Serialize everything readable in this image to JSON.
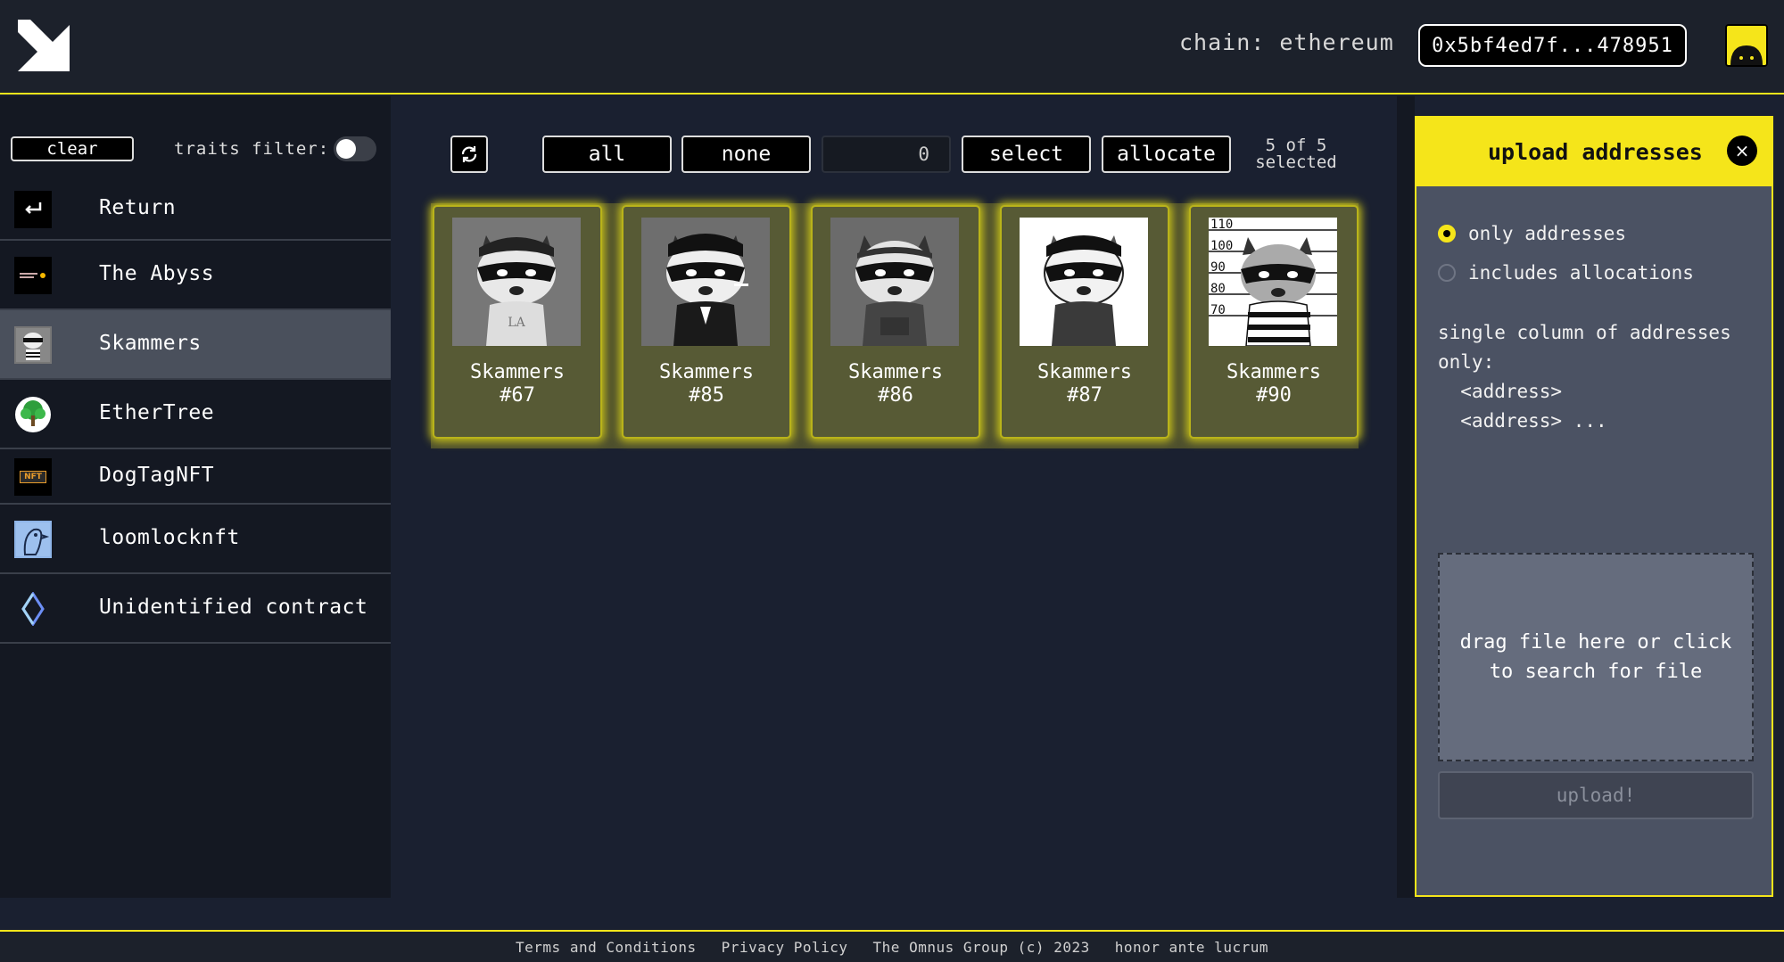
{
  "header": {
    "chain_text": "chain: ethereum",
    "wallet_address": "0x5bf4ed7f...478951"
  },
  "sidebar": {
    "clear_label": "clear",
    "traits_filter_label": "traits filter:",
    "traits_filter_on": false,
    "collections": [
      {
        "name": "Return",
        "icon": "return-icon",
        "active": false
      },
      {
        "name": "The Abyss",
        "icon": "abyss-logo",
        "active": false
      },
      {
        "name": "Skammers",
        "icon": "skammers-avatar",
        "active": true
      },
      {
        "name": "EtherTree",
        "icon": "tree-icon",
        "active": false
      },
      {
        "name": "DogTagNFT",
        "icon": "nft-tag-icon",
        "active": false
      },
      {
        "name": "loomlocknft",
        "icon": "bird-icon",
        "active": false
      },
      {
        "name": "Unidentified contract",
        "icon": "ethereum-icon",
        "active": false
      }
    ],
    "dogtag_icon_text": "NFT"
  },
  "toolbar": {
    "all_label": "all",
    "none_label": "none",
    "quantity_value": "0",
    "select_label": "select",
    "allocate_label": "allocate",
    "selected_line1": "5 of 5",
    "selected_line2": "selected"
  },
  "nfts": [
    {
      "name": "Skammers",
      "id": "#67"
    },
    {
      "name": "Skammers",
      "id": "#85"
    },
    {
      "name": "Skammers",
      "id": "#86"
    },
    {
      "name": "Skammers",
      "id": "#87"
    },
    {
      "name": "Skammers",
      "id": "#90"
    }
  ],
  "mugshot_labels": [
    "110",
    "100",
    "90",
    "80",
    "70"
  ],
  "upload_panel": {
    "title": "upload addresses",
    "close_label": "×",
    "options": [
      {
        "label": "only addresses",
        "checked": true
      },
      {
        "label": "includes allocations",
        "checked": false
      }
    ],
    "help_text": "single column of addresses\nonly:\n  <address>\n  <address> ...",
    "dropzone_text": "drag file here or click to search for file",
    "upload_label": "upload!"
  },
  "footer": {
    "terms": "Terms and Conditions",
    "privacy": "Privacy Policy",
    "copyright": "The Omnus Group (c) 2023",
    "motto": "honor ante lucrum"
  },
  "colors": {
    "accent": "#f5e51a",
    "bg": "#1a2030",
    "sidebar_bg": "#141822",
    "card_bg": "#575a35"
  }
}
